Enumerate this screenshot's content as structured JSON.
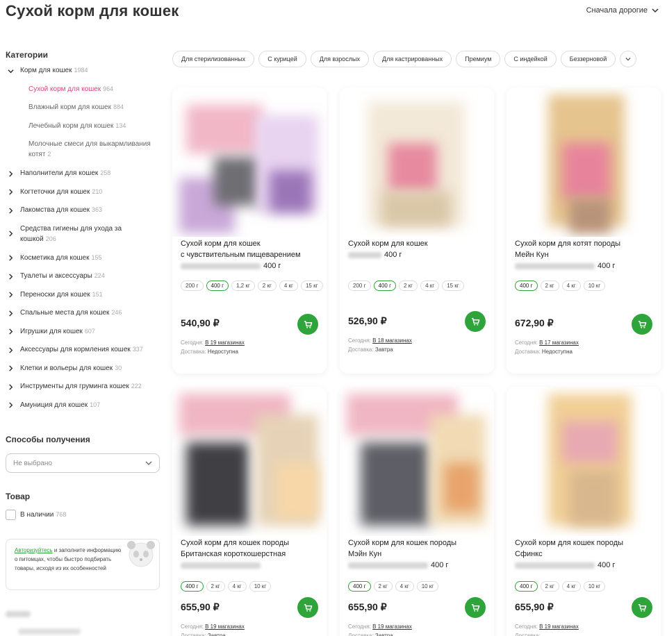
{
  "page": {
    "title": "Сухой корм для кошек",
    "sort_label": "Сначала дорогие"
  },
  "sidebar": {
    "categories_heading": "Категории",
    "main_category": {
      "label": "Корм для кошек",
      "count": "1984"
    },
    "subcategories": [
      {
        "label": "Сухой корм для кошек",
        "count": "964",
        "active": true
      },
      {
        "label": "Влажный корм для кошек",
        "count": "884",
        "active": false
      },
      {
        "label": "Лечебный корм для кошек",
        "count": "134",
        "active": false
      },
      {
        "label": "Молочные смеси для выкармливания котят",
        "count": "2",
        "active": false
      }
    ],
    "categories": [
      {
        "label": "Наполнители для кошек",
        "count": "258"
      },
      {
        "label": "Когтеточки для кошек",
        "count": "210"
      },
      {
        "label": "Лакомства для кошек",
        "count": "363"
      },
      {
        "label": "Средства гигиены для ухода за кошкой",
        "count": "206"
      },
      {
        "label": "Косметика для кошек",
        "count": "155"
      },
      {
        "label": "Туалеты и аксессуары",
        "count": "224"
      },
      {
        "label": "Переноски для кошек",
        "count": "151"
      },
      {
        "label": "Спальные места для кошек",
        "count": "246"
      },
      {
        "label": "Игрушки для кошек",
        "count": "607"
      },
      {
        "label": "Аксессуары для кормления кошек",
        "count": "337"
      },
      {
        "label": "Клетки и вольеры для кошек",
        "count": "30"
      },
      {
        "label": "Инструменты для груминга кошек",
        "count": "222"
      },
      {
        "label": "Амуниция для кошек",
        "count": "107"
      }
    ],
    "delivery_heading": "Способы получения",
    "delivery_select": "Не выбрано",
    "product_heading": "Товар",
    "in_stock_label": "В наличии",
    "in_stock_count": "768",
    "promo_link": "Авторизуйтесь",
    "promo_text": " и заполните информацию о питомцах, чтобы быстро подбирать товары, исходя из их особенностей"
  },
  "chips": [
    "Для стерилизованных",
    "С курицей",
    "Для взрослых",
    "Для кастрированных",
    "Премиум",
    "С индейкой",
    "Беззерновой"
  ],
  "labels": {
    "today": "Сегодня:",
    "delivery": "Доставка:"
  },
  "products": [
    {
      "name_parts": [
        "Сухой корм для кошек",
        "с чувствительным пищеварением"
      ],
      "weight_suffix": "400 г",
      "weights": [
        "200 г",
        "400 г",
        "1,2 кг",
        "2 кг",
        "4 кг",
        "15 кг"
      ],
      "selected": "400 г",
      "price": "540,90 ₽",
      "stores": "В 19 магазинах",
      "delivery": "Недоступна"
    },
    {
      "name_parts": [
        "Сухой корм для кошек"
      ],
      "weight_suffix": "400 г",
      "weights": [
        "200 г",
        "400 г",
        "2 кг",
        "4 кг",
        "15 кг"
      ],
      "selected": "400 г",
      "price": "526,90 ₽",
      "stores": "В 18 магазинах",
      "delivery": "Завтра"
    },
    {
      "name_parts": [
        "Сухой корм для котят породы",
        "Мейн Кун"
      ],
      "weight_suffix": "400 г",
      "weights": [
        "400 г",
        "2 кг",
        "4 кг",
        "10 кг"
      ],
      "selected": "400 г",
      "price": "672,90 ₽",
      "stores": "В 17 магазинах",
      "delivery": "Недоступна"
    },
    {
      "name_parts": [
        "Сухой корм для кошек породы",
        "Британская короткошерстная"
      ],
      "weight_suffix": "",
      "weights": [
        "400 г",
        "2 кг",
        "4 кг",
        "10 кг"
      ],
      "selected": "400 г",
      "price": "655,90 ₽",
      "stores": "В 19 магазинах",
      "delivery": "Завтра"
    },
    {
      "name_parts": [
        "Сухой корм для кошек породы",
        "Мэйн Кун"
      ],
      "weight_suffix": "400 г",
      "weights": [
        "400 г",
        "2 кг",
        "4 кг",
        "10 кг"
      ],
      "selected": "400 г",
      "price": "655,90 ₽",
      "stores": "В 19 магазинах",
      "delivery": "Завтра"
    },
    {
      "name_parts": [
        "Сухой корм для кошек породы",
        "Сфинкс"
      ],
      "weight_suffix": "400 г",
      "weights": [
        "400 г",
        "2 кг",
        "4 кг",
        "10 кг"
      ],
      "selected": "400 г",
      "price": "655,90 ₽",
      "stores": "В 19 магазинах",
      "delivery": ""
    }
  ],
  "colors": {
    "accent_green": "#2fa43a",
    "active_pink": "#d6457c"
  }
}
